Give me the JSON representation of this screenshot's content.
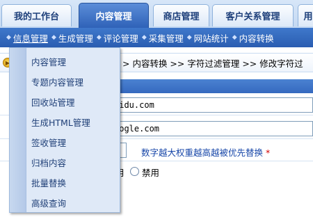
{
  "tabs": [
    {
      "label": "我的工作台",
      "active": false
    },
    {
      "label": "内容管理",
      "active": true
    },
    {
      "label": "商店管理",
      "active": false
    },
    {
      "label": "客户关系管理",
      "active": false
    },
    {
      "label": "用",
      "active": false
    }
  ],
  "subnav": {
    "items": [
      "信息管理",
      "生成管理",
      "评论管理",
      "采集管理",
      "网站统计",
      "内容转换"
    ]
  },
  "breadcrumb": {
    "path": "> 内容转换 >> 字符过滤管理 >> 修改字符过"
  },
  "form": {
    "field1_value": "aidu.com",
    "field2_value": "oogle.com",
    "hint_text": "数字越大权重越高越被优先替换",
    "required_mark": "*",
    "radio_enabled_label": "用",
    "radio_disabled_label": "禁用"
  },
  "menu": {
    "items": [
      "内容管理",
      "专题内容管理",
      "回收站管理",
      "生成HTML管理",
      "签收管理",
      "归档内容",
      "批量替换",
      "高级查询"
    ]
  }
}
